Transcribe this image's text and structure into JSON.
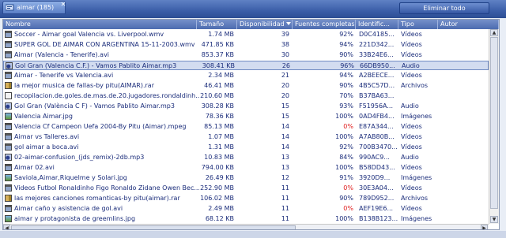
{
  "tab": {
    "label": "aimar (185)"
  },
  "toolbar": {
    "clear_all_label": "Eliminar todo"
  },
  "columns": {
    "name": "Nombre",
    "size": "Tamaño",
    "availability": "Disponibilidad",
    "complete_sources": "Fuentes completas",
    "identifier": "Identific...",
    "type": "Tipo",
    "author": "Autor"
  },
  "rows": [
    {
      "name": "Soccer - Aimar goal Valencia vs. Liverpool.wmv",
      "size": "1.74 MB",
      "avail": "39",
      "src": "92%",
      "id": "D0C4185...",
      "type": "Vídeos",
      "icon": "video",
      "red": false,
      "sel": false
    },
    {
      "name": "SUPER GOL DE AIMAR CON ARGENTINA 15-11-2003.wmv",
      "size": "471.85 KB",
      "avail": "38",
      "src": "94%",
      "id": "221D342...",
      "type": "Vídeos",
      "icon": "video",
      "red": false,
      "sel": false
    },
    {
      "name": "Aimar (Valencia - Tenerife).avi",
      "size": "853.37 KB",
      "avail": "30",
      "src": "90%",
      "id": "33B24E6...",
      "type": "Vídeos",
      "icon": "video",
      "red": false,
      "sel": false
    },
    {
      "name": "Gol Gran (Valencia C.F.) - Vamos Pablito Aimar.mp3",
      "size": "308.41 KB",
      "avail": "26",
      "src": "96%",
      "id": "66DB950...",
      "type": "Audio",
      "icon": "audio",
      "red": false,
      "sel": true
    },
    {
      "name": "Aimar - Tenerife vs Valencia.avi",
      "size": "2.34 MB",
      "avail": "21",
      "src": "94%",
      "id": "A2BEECE...",
      "type": "Vídeos",
      "icon": "video",
      "red": false,
      "sel": false
    },
    {
      "name": "la mejor musica de fallas-by pitu(AIMAR).rar",
      "size": "46.41 MB",
      "avail": "20",
      "src": "90%",
      "id": "4B5C57D...",
      "type": "Archivos",
      "icon": "arch",
      "red": false,
      "sel": false
    },
    {
      "name": "recopilacion.de.goles.de.mas.de.20.jugadores.rondaldinh...",
      "size": "210.60 MB",
      "avail": "20",
      "src": "70%",
      "id": "B37BA63...",
      "type": "",
      "icon": "doc",
      "red": false,
      "sel": false
    },
    {
      "name": "Gol Gran (València C F) - Vamos Pablito Aimar.mp3",
      "size": "308.28 KB",
      "avail": "15",
      "src": "93%",
      "id": "F51956A...",
      "type": "Audio",
      "icon": "audio",
      "red": false,
      "sel": false
    },
    {
      "name": "Valencia Aimar.jpg",
      "size": "78.36 KB",
      "avail": "15",
      "src": "100%",
      "id": "0AD4FB4...",
      "type": "Imágenes",
      "icon": "img",
      "red": false,
      "sel": false
    },
    {
      "name": "Valencia Cf Campeon Uefa 2004-By Pitu (Aimar).mpeg",
      "size": "85.13 MB",
      "avail": "14",
      "src": "0%",
      "id": "E87A344...",
      "type": "Vídeos",
      "icon": "video",
      "red": true,
      "sel": false
    },
    {
      "name": "Aimar vs Talleres.avi",
      "size": "1.07 MB",
      "avail": "14",
      "src": "100%",
      "id": "A7AB80B...",
      "type": "Vídeos",
      "icon": "video",
      "red": false,
      "sel": false
    },
    {
      "name": "gol aimar a boca.avi",
      "size": "1.31 MB",
      "avail": "14",
      "src": "92%",
      "id": "700B3470...",
      "type": "Vídeos",
      "icon": "video",
      "red": false,
      "sel": false
    },
    {
      "name": "02-aimar-confusion_(jds_remix)-2db.mp3",
      "size": "10.83 MB",
      "avail": "13",
      "src": "84%",
      "id": "990AC9...",
      "type": "Audio",
      "icon": "audio",
      "red": false,
      "sel": false
    },
    {
      "name": "Aimar 02.avi",
      "size": "794.00 KB",
      "avail": "13",
      "src": "100%",
      "id": "B58DD43...",
      "type": "Vídeos",
      "icon": "video",
      "red": false,
      "sel": false
    },
    {
      "name": "Saviola,Aimar,Riquelme y Solari.jpg",
      "size": "26.49 KB",
      "avail": "12",
      "src": "91%",
      "id": "3920D9...",
      "type": "Imágenes",
      "icon": "img",
      "red": false,
      "sel": false
    },
    {
      "name": "Videos Futbol Ronaldinho Figo Ronaldo Zidane Owen Bec...",
      "size": "252.90 MB",
      "avail": "11",
      "src": "0%",
      "id": "30E3A04...",
      "type": "Vídeos",
      "icon": "video",
      "red": true,
      "sel": false
    },
    {
      "name": "las mejores canciones romanticas-by pitu(aimar).rar",
      "size": "106.02 MB",
      "avail": "11",
      "src": "90%",
      "id": "789D952...",
      "type": "Archivos",
      "icon": "arch",
      "red": false,
      "sel": false
    },
    {
      "name": "Aimar caño y asistencia de gol.avi",
      "size": "2.49 MB",
      "avail": "11",
      "src": "0%",
      "id": "AEF19E6...",
      "type": "Vídeos",
      "icon": "video",
      "red": true,
      "sel": false
    },
    {
      "name": "aimar y protagonista de greemlins.jpg",
      "size": "68.12 KB",
      "avail": "11",
      "src": "100%",
      "id": "B138B123...",
      "type": "Imágenes",
      "icon": "img",
      "red": false,
      "sel": false
    }
  ]
}
